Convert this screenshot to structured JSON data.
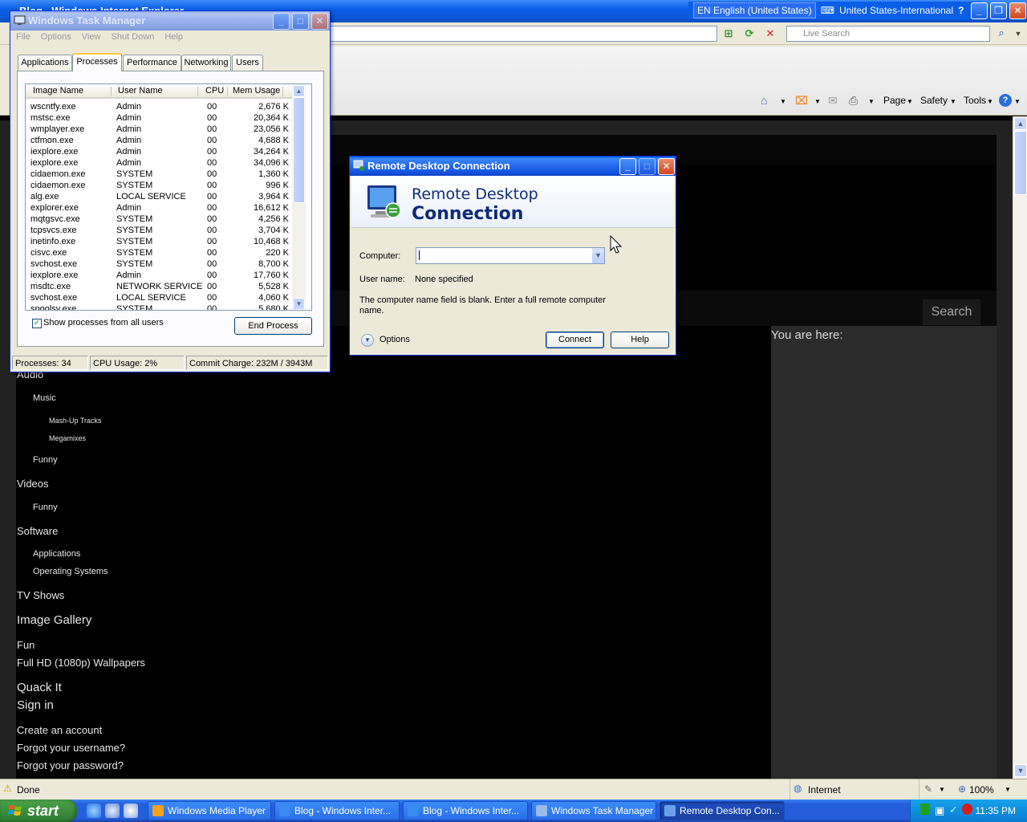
{
  "ie": {
    "title_partial": "Blog - Windows Internet Explorer",
    "search_placeholder": "Live Search",
    "lang_indicator": "EN English (United States)",
    "keyboard_layout": "United States-International",
    "commands": {
      "page": "Page",
      "safety": "Safety",
      "tools": "Tools"
    },
    "status": {
      "text": "Done",
      "zone": "Internet",
      "zoom": "100%"
    }
  },
  "website": {
    "search_button": "Search",
    "breadcrumb_label": "You are here:",
    "nav": [
      {
        "label": "Audio",
        "level": "lvl1"
      },
      {
        "label": "Music",
        "level": "lvl2"
      },
      {
        "label": "Mash-Up Tracks",
        "level": "lvl3"
      },
      {
        "label": "Megamixes",
        "level": "lvl3"
      },
      {
        "label": "Funny",
        "level": "lvl2"
      },
      {
        "label": "Videos",
        "level": "lvl1"
      },
      {
        "label": "Funny",
        "level": "lvl2"
      },
      {
        "label": "Software",
        "level": "lvl1"
      },
      {
        "label": "Applications",
        "level": "lvl2"
      },
      {
        "label": "Operating Systems",
        "level": "lvl2"
      },
      {
        "label": "TV Shows",
        "level": "lvl1"
      },
      {
        "label": "Image Gallery",
        "level": "big"
      },
      {
        "label": "Fun",
        "level": "lvl1"
      },
      {
        "label": "Full HD (1080p) Wallpapers",
        "level": "lvl1"
      },
      {
        "label": "Quack It",
        "level": "big"
      },
      {
        "label": "Sign in",
        "level": "big"
      },
      {
        "label": "Create an account",
        "level": "acct"
      },
      {
        "label": "Forgot your username?",
        "level": "acct"
      },
      {
        "label": "Forgot your password?",
        "level": "acct"
      }
    ]
  },
  "taskmgr": {
    "title": "Windows Task Manager",
    "menu": [
      "File",
      "Options",
      "View",
      "Shut Down",
      "Help"
    ],
    "tabs": [
      "Applications",
      "Processes",
      "Performance",
      "Networking",
      "Users"
    ],
    "selected_tab": "Processes",
    "columns": [
      "Image Name",
      "User Name",
      "CPU",
      "Mem Usage"
    ],
    "rows": [
      [
        "wscntfy.exe",
        "Admin",
        "00",
        "2,676 K"
      ],
      [
        "mstsc.exe",
        "Admin",
        "00",
        "20,364 K"
      ],
      [
        "wmplayer.exe",
        "Admin",
        "00",
        "23,056 K"
      ],
      [
        "ctfmon.exe",
        "Admin",
        "00",
        "4,688 K"
      ],
      [
        "iexplore.exe",
        "Admin",
        "00",
        "34,264 K"
      ],
      [
        "iexplore.exe",
        "Admin",
        "00",
        "34,096 K"
      ],
      [
        "cidaemon.exe",
        "SYSTEM",
        "00",
        "1,360 K"
      ],
      [
        "cidaemon.exe",
        "SYSTEM",
        "00",
        "996 K"
      ],
      [
        "alg.exe",
        "LOCAL SERVICE",
        "00",
        "3,964 K"
      ],
      [
        "explorer.exe",
        "Admin",
        "00",
        "16,612 K"
      ],
      [
        "mqtgsvc.exe",
        "SYSTEM",
        "00",
        "4,256 K"
      ],
      [
        "tcpsvcs.exe",
        "SYSTEM",
        "00",
        "3,704 K"
      ],
      [
        "inetinfo.exe",
        "SYSTEM",
        "00",
        "10,468 K"
      ],
      [
        "cisvc.exe",
        "SYSTEM",
        "00",
        "220 K"
      ],
      [
        "svchost.exe",
        "SYSTEM",
        "00",
        "8,700 K"
      ],
      [
        "iexplore.exe",
        "Admin",
        "00",
        "17,760 K"
      ],
      [
        "msdtc.exe",
        "NETWORK SERVICE",
        "00",
        "5,528 K"
      ],
      [
        "svchost.exe",
        "LOCAL SERVICE",
        "00",
        "4,060 K"
      ],
      [
        "spoolsv.exe",
        "SYSTEM",
        "00",
        "5,680 K"
      ]
    ],
    "show_all_label": "Show processes from all users",
    "end_process_label": "End Process",
    "status": {
      "processes": "Processes: 34",
      "cpu": "CPU Usage: 2%",
      "commit": "Commit Charge: 232M / 3943M"
    }
  },
  "rdc": {
    "title": "Remote Desktop Connection",
    "banner_line1": "Remote Desktop",
    "banner_line2": "Connection",
    "computer_label": "Computer:",
    "computer_value": "",
    "username_label": "User name:",
    "username_value": "None specified",
    "hint": "The computer name field is blank. Enter a full remote computer name.",
    "options_label": "Options",
    "connect_label": "Connect",
    "help_label": "Help"
  },
  "taskbar": {
    "start_label": "start",
    "buttons": [
      {
        "label": "Windows Media Player",
        "icon_color": "#f4a020"
      },
      {
        "label": "Blog - Windows Inter...",
        "icon_color": "#3a8af0"
      },
      {
        "label": "Blog - Windows Inter...",
        "icon_color": "#3a8af0"
      },
      {
        "label": "Windows Task Manager",
        "icon_color": "#9ab8e8"
      },
      {
        "label": "Remote Desktop Con...",
        "icon_color": "#6aa0e8"
      }
    ],
    "clock": "11:35 PM"
  }
}
